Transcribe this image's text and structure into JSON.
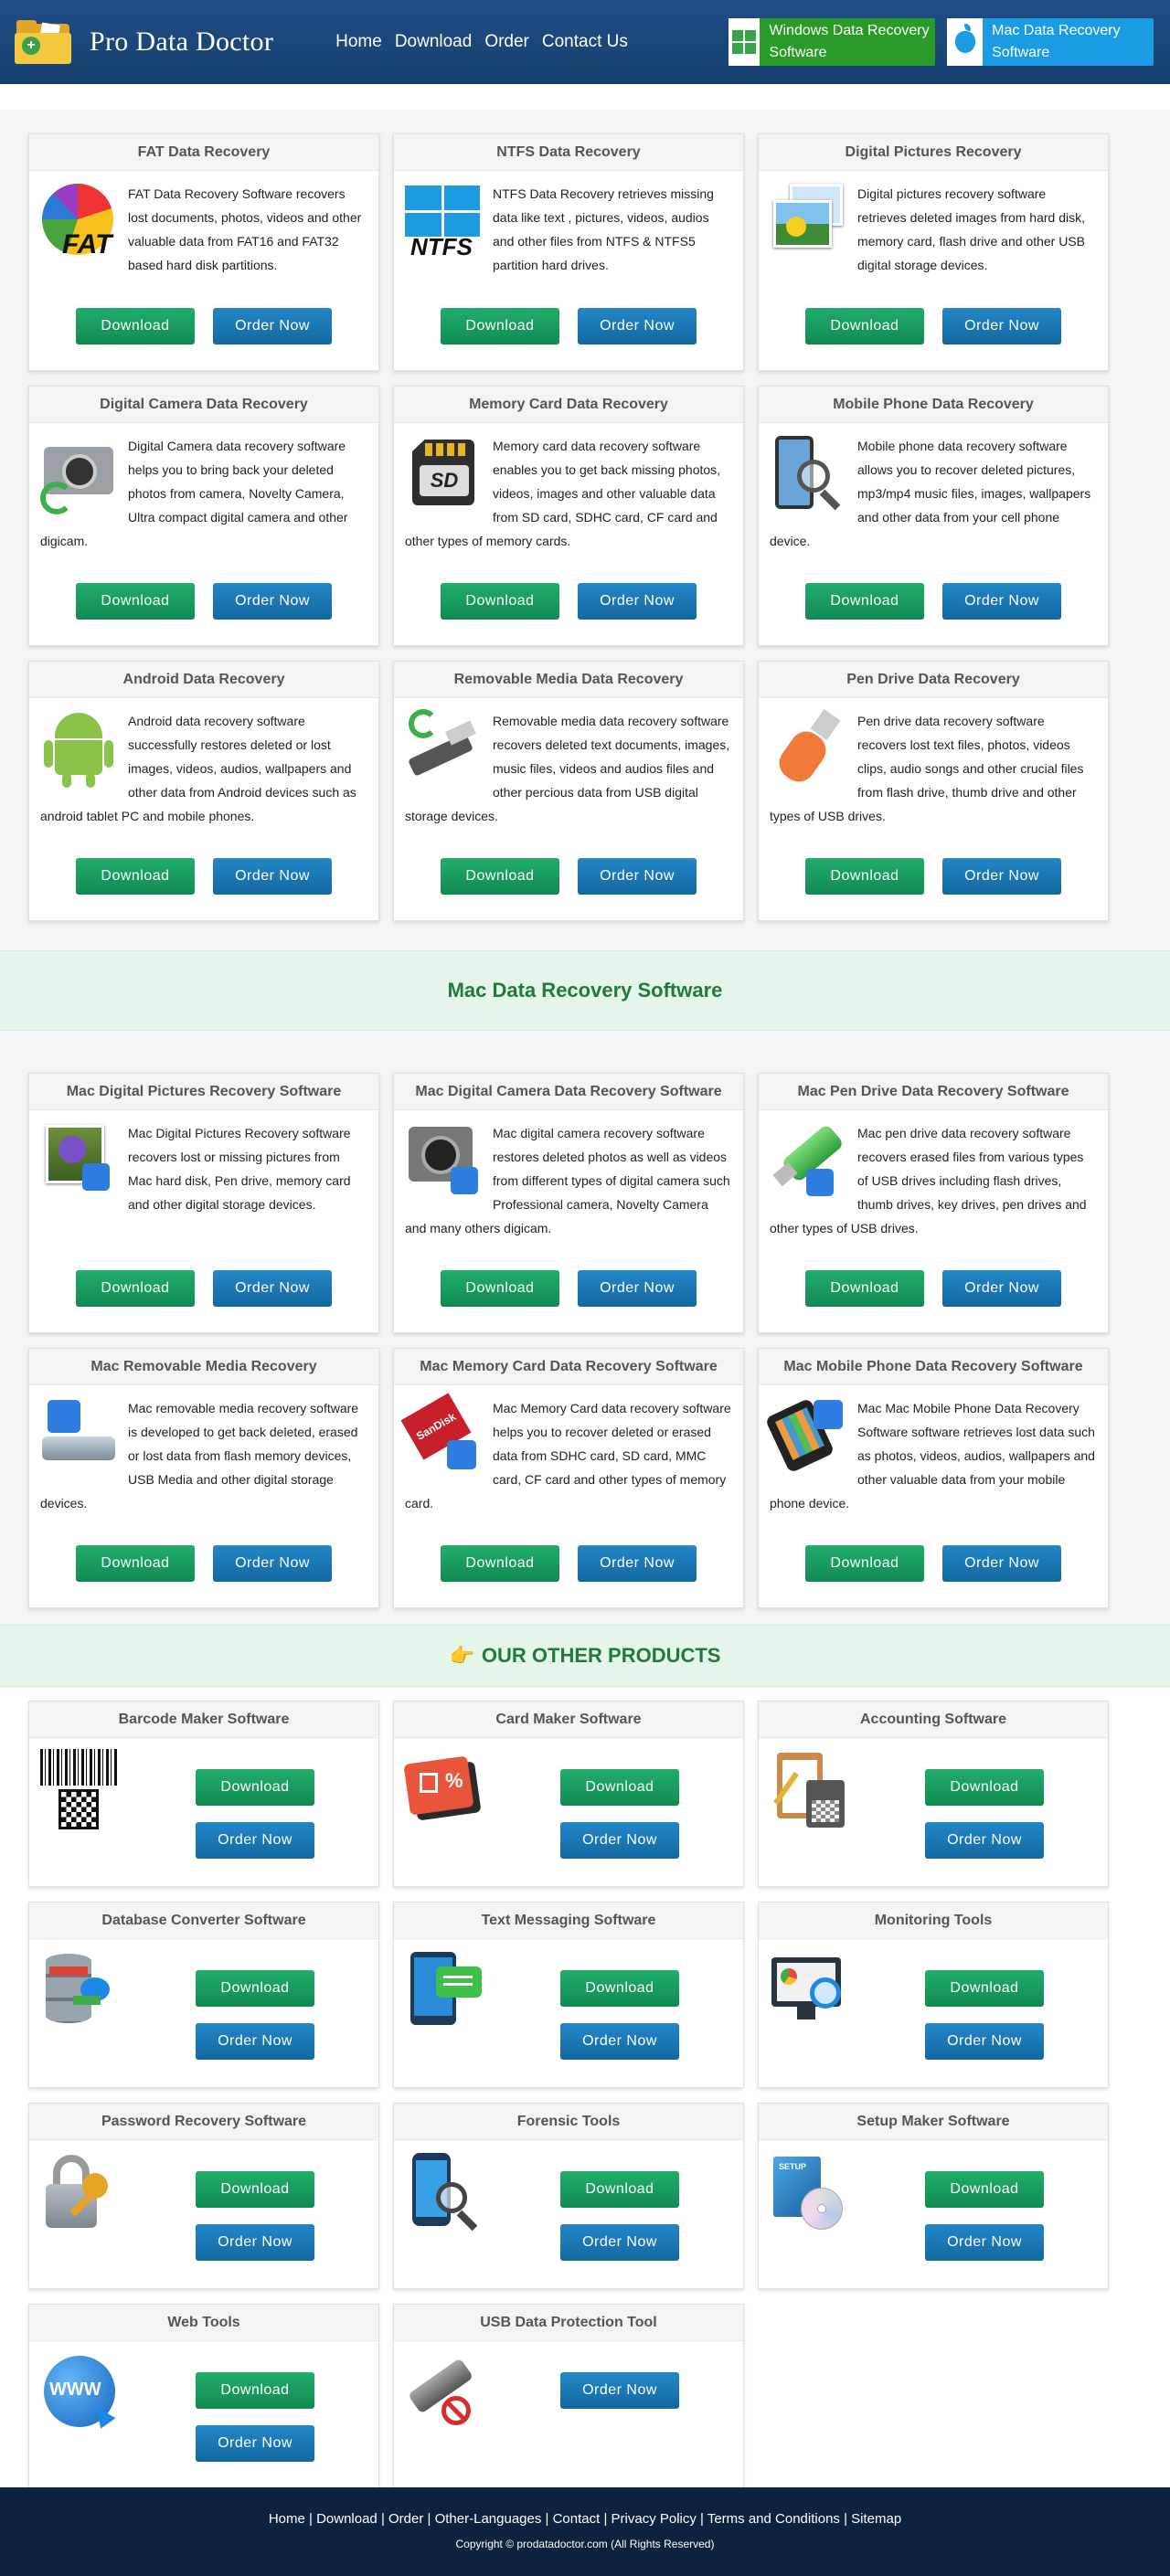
{
  "brand": {
    "name": "Pro Data Doctor"
  },
  "nav": [
    "Home",
    "Download",
    "Order",
    "Contact Us"
  ],
  "header_buttons": {
    "windows": "Windows Data Recovery Software",
    "mac": "Mac Data Recovery Software"
  },
  "buttons": {
    "download": "Download",
    "order": "Order Now"
  },
  "windows_products": [
    {
      "title": "FAT Data Recovery",
      "icon": "fat-pie-icon",
      "text": "FAT Data Recovery Software recovers lost documents, photos, videos and other valuable data from FAT16 and FAT32 based hard disk partitions.",
      "icon_label": "FAT"
    },
    {
      "title": "NTFS Data Recovery",
      "icon": "ntfs-windows-icon",
      "text": "NTFS Data Recovery retrieves missing data like text , pictures, videos, audios and other files from NTFS & NTFS5 partition hard drives.",
      "icon_label": "NTFS"
    },
    {
      "title": "Digital Pictures Recovery",
      "icon": "photos-icon",
      "text": "Digital pictures recovery software retrieves deleted images from hard disk, memory card, flash drive and other USB digital storage devices."
    },
    {
      "title": "Digital Camera Data Recovery",
      "icon": "camera-icon",
      "text": "Digital Camera data recovery software helps you to bring back your deleted photos from camera, Novelty Camera, Ultra compact digital camera and other digicam."
    },
    {
      "title": "Memory Card Data Recovery",
      "icon": "sd-card-icon",
      "text": "Memory card data recovery software enables you to get back missing photos, videos, images and other valuable data from SD card, SDHC card, CF card and other types of memory cards.",
      "icon_label": "SD"
    },
    {
      "title": "Mobile Phone Data Recovery",
      "icon": "mobile-magnifier-icon",
      "text": "Mobile phone data recovery software allows you to recover deleted pictures, mp3/mp4 music files, images, wallpapers and other data from your cell phone device."
    },
    {
      "title": "Android Data Recovery",
      "icon": "android-icon",
      "text": "Android data recovery software successfully restores deleted or lost images, videos, audios, wallpapers and other data from Android devices such as android tablet PC and mobile phones."
    },
    {
      "title": "Removable Media Data Recovery",
      "icon": "usb-cable-icon",
      "text": "Removable media data recovery software recovers deleted text documents, images, music files, videos and audios files and other percious data from USB digital storage devices."
    },
    {
      "title": "Pen Drive Data Recovery",
      "icon": "pen-drive-icon",
      "text": "Pen drive data recovery software recovers lost text files, photos, videos clips, audio songs and other crucial files from flash drive, thumb drive and other types of USB drives."
    }
  ],
  "mac_section_title": "Mac Data Recovery Software",
  "mac_products": [
    {
      "title": "Mac Digital Pictures Recovery Software",
      "icon": "mac-flower-photo-icon",
      "text": "Mac Digital Pictures Recovery software recovers lost or missing pictures from Mac hard disk, Pen drive, memory card and other digital storage devices."
    },
    {
      "title": "Mac Digital Camera Data Recovery Software",
      "icon": "mac-camera-icon",
      "text": "Mac digital camera recovery software restores deleted photos as well as videos from different types of digital camera such Professional camera, Novelty Camera and many others digicam."
    },
    {
      "title": "Mac Pen Drive Data Recovery Software",
      "icon": "mac-usb-drive-icon",
      "text": "Mac pen drive data recovery software recovers erased files from various types of USB drives including flash drives, thumb drives, key drives, pen drives and other types of USB drives."
    },
    {
      "title": "Mac Removable Media Recovery",
      "icon": "mac-hard-drive-icon",
      "text": "Mac removable media recovery software is developed to get back deleted, erased or lost data from flash memory devices, USB Media and other digital storage devices."
    },
    {
      "title": "Mac Memory Card Data Recovery Software",
      "icon": "mac-sandisk-card-icon",
      "text": "Mac Memory Card data recovery software helps you to recover deleted or erased data from SDHC card, SD card, MMC card, CF card and other types of memory card.",
      "icon_label": "SanDisk"
    },
    {
      "title": "Mac Mobile Phone Data Recovery Software",
      "icon": "mac-smartphone-icon",
      "text": "Mac Mac Mobile Phone Data Recovery Software software retrieves lost data such as photos, videos, audios, wallpapers and other valuable data from your mobile phone device."
    }
  ],
  "other_title": {
    "emoji": "👉",
    "text": "OUR OTHER PRODUCTS"
  },
  "other_products": [
    {
      "title": "Barcode Maker Software",
      "icon": "barcode-qr-icon",
      "download": true
    },
    {
      "title": "Card Maker Software",
      "icon": "gift-card-icon",
      "download": true
    },
    {
      "title": "Accounting Software",
      "icon": "calculator-clipboard-icon",
      "download": true
    },
    {
      "title": "Database Converter Software",
      "icon": "database-convert-icon",
      "download": true
    },
    {
      "title": "Text Messaging Software",
      "icon": "sms-tablet-icon",
      "download": true
    },
    {
      "title": "Monitoring Tools",
      "icon": "monitor-magnifier-icon",
      "download": true
    },
    {
      "title": "Password Recovery Software",
      "icon": "padlock-key-icon",
      "download": true
    },
    {
      "title": "Forensic Tools",
      "icon": "phone-fingerprint-icon",
      "download": true
    },
    {
      "title": "Setup Maker Software",
      "icon": "setup-box-cd-icon",
      "download": true,
      "icon_label": "SETUP"
    },
    {
      "title": "Web Tools",
      "icon": "www-globe-icon",
      "download": true,
      "icon_label": "WWW"
    },
    {
      "title": "USB Data Protection Tool",
      "icon": "usb-blocked-icon",
      "download": false
    }
  ],
  "footer": {
    "links": [
      "Home",
      "Download",
      "Order",
      "Other-Languages",
      "Contact",
      "Privacy Policy",
      "Terms and Conditions",
      "Sitemap"
    ],
    "copyright": "Copyright © prodatadoctor.com (All Rights Reserved)"
  },
  "colors": {
    "header": "#1f4e86",
    "download": "#18995d",
    "order": "#1a78b5",
    "windows_btn": "#2a9a28",
    "mac_btn": "#1a9be3",
    "footer": "#0c2240",
    "section_title": "#207a3c"
  }
}
